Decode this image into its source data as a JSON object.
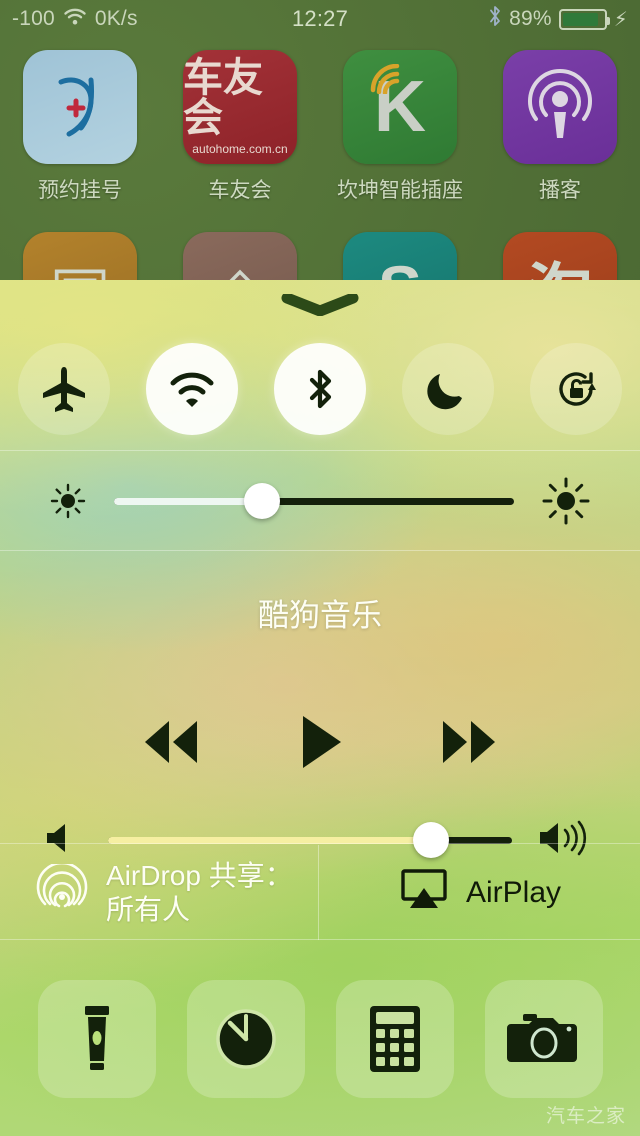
{
  "status_bar": {
    "signal_text": "-100",
    "wifi_icon": "wifi-icon",
    "network_speed": "0K/s",
    "time": "12:27",
    "bluetooth_icon": "bluetooth-icon",
    "battery_percent": "89%",
    "battery_level": 89,
    "charging_icon": "lightning-bolt-icon"
  },
  "home_screen": {
    "row1": [
      {
        "label": "预约挂号",
        "icon": "medical-appointment-icon",
        "glyph": "♡"
      },
      {
        "label": "车友会",
        "icon": "autohome-icon",
        "title": "车友会",
        "subtitle": "autohome.com.cn"
      },
      {
        "label": "坎坤智能插座",
        "icon": "smart-plug-icon",
        "glyph": "K"
      },
      {
        "label": "播客",
        "icon": "podcasts-icon",
        "glyph": "ⓘ"
      }
    ],
    "row2": [
      {
        "label": "",
        "icon": "app-icon-orange",
        "glyph": "▣"
      },
      {
        "label": "",
        "icon": "cydia-icon",
        "glyph": "◈"
      },
      {
        "label": "",
        "icon": "app-icon-teal",
        "glyph": "S"
      },
      {
        "label": "",
        "icon": "taobao-icon",
        "glyph": "淘"
      }
    ]
  },
  "control_center": {
    "grabber": "grabber-handle",
    "toggles": [
      {
        "name": "airplane-mode",
        "icon": "airplane-icon",
        "state": "off"
      },
      {
        "name": "wifi",
        "icon": "wifi-icon",
        "state": "on"
      },
      {
        "name": "bluetooth",
        "icon": "bluetooth-icon",
        "state": "on"
      },
      {
        "name": "do-not-disturb",
        "icon": "moon-icon",
        "state": "off"
      },
      {
        "name": "rotation-lock",
        "icon": "rotation-lock-icon",
        "state": "off"
      }
    ],
    "brightness": {
      "label": "brightness-slider",
      "value": 37,
      "min_icon": "sun-small-icon",
      "max_icon": "sun-large-icon"
    },
    "music": {
      "now_playing": "酷狗音乐",
      "controls": [
        {
          "name": "rewind-button",
          "icon": "rewind-icon"
        },
        {
          "name": "play-button",
          "icon": "play-icon"
        },
        {
          "name": "fast-forward-button",
          "icon": "fast-forward-icon"
        }
      ],
      "volume": {
        "label": "volume-slider",
        "value": 80,
        "min_icon": "speaker-mute-icon",
        "max_icon": "speaker-loud-icon"
      }
    },
    "airdrop": {
      "icon": "airdrop-icon",
      "line1": "AirDrop 共享：",
      "line2": "所有人"
    },
    "airplay": {
      "icon": "airplay-icon",
      "label": "AirPlay"
    },
    "shortcuts": [
      {
        "name": "flashlight-button",
        "icon": "flashlight-icon"
      },
      {
        "name": "timer-button",
        "icon": "timer-icon"
      },
      {
        "name": "calculator-button",
        "icon": "calculator-icon"
      },
      {
        "name": "camera-button",
        "icon": "camera-icon"
      }
    ]
  },
  "watermark": "汽车之家",
  "colors": {
    "panel_accent_green": "#a6d45e",
    "panel_accent_yellow": "#d8e07a",
    "icon_dark": "#13210b",
    "toggle_on_bg": "#ffffff",
    "battery_green": "#2f7a3a"
  }
}
